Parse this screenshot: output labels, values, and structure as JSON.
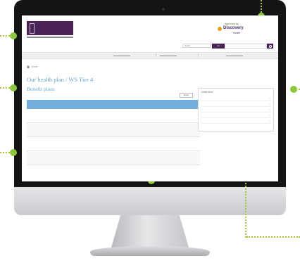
{
  "header": {
    "partner_small": "Approved by",
    "partner_name": "Discovery",
    "partner_sub": "Health"
  },
  "topbar": {
    "search_placeholder": "Search",
    "search_button": "Go"
  },
  "nav": {
    "tabs": [
      "",
      "",
      ""
    ]
  },
  "breadcrumb": {
    "text": "Home"
  },
  "page": {
    "title": "Our health plan / WS Tier 4",
    "section_title": "Benefit plans",
    "export_label": "Export"
  },
  "table": {
    "headers": [
      "",
      "",
      "",
      "",
      "",
      "",
      "",
      ""
    ],
    "rows": [
      [
        "",
        "",
        "",
        "",
        "",
        "",
        "",
        ""
      ],
      [
        "",
        "",
        "",
        "",
        "",
        "",
        "",
        ""
      ],
      [
        "",
        "",
        "",
        "",
        "",
        "",
        "",
        ""
      ],
      [
        "",
        "",
        "",
        "",
        "",
        "",
        "",
        ""
      ]
    ]
  },
  "panel": {
    "title": "Useful links",
    "items": [
      "",
      "",
      "",
      "",
      ""
    ]
  },
  "colors": {
    "brand_purple": "#4b2255",
    "accent_blue": "#6ba4c8",
    "table_header": "#71aedb",
    "callout_green": "#8dc63f",
    "bezel": "#141414"
  }
}
